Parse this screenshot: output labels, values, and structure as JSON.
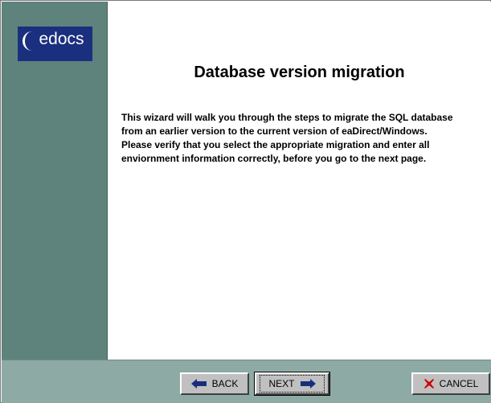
{
  "logo": {
    "text": "edocs"
  },
  "main": {
    "title": "Database version migration",
    "description": "This wizard will walk you through the steps to migrate the SQL database from an earlier version to the current version of eaDirect/Windows. Please verify that you select the appropriate migration and enter all enviornment information correctly, before you go to the next page."
  },
  "footer": {
    "back_label": "BACK",
    "next_label": "NEXT",
    "cancel_label": "CANCEL"
  },
  "icons": {
    "back": "arrow-left-icon",
    "next": "arrow-right-icon",
    "cancel": "x-icon"
  },
  "colors": {
    "sidebar": "#5e837c",
    "footer": "#8eaaa4",
    "logo_bg": "#1b2f7f",
    "arrow": "#1a2d7c",
    "cancel_x": "#cc0000"
  }
}
